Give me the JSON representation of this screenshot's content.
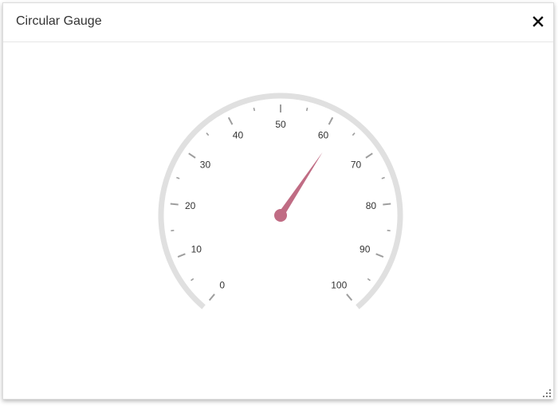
{
  "dialog": {
    "title": "Circular Gauge",
    "close_icon": "close-icon",
    "resize_icon": "resize-grip-icon"
  },
  "gauge": {
    "min": 0,
    "max": 100,
    "value": 62,
    "start_angle_deg": 220,
    "end_angle_deg": 140,
    "major_interval": 10,
    "minor_interval": 5,
    "labels": [
      "0",
      "10",
      "20",
      "30",
      "40",
      "50",
      "60",
      "70",
      "80",
      "90",
      "100"
    ],
    "colors": {
      "track": "#e0e0e0",
      "ticks": "#9e9e9e",
      "needle": "#c06c84",
      "label": "#333333"
    }
  }
}
